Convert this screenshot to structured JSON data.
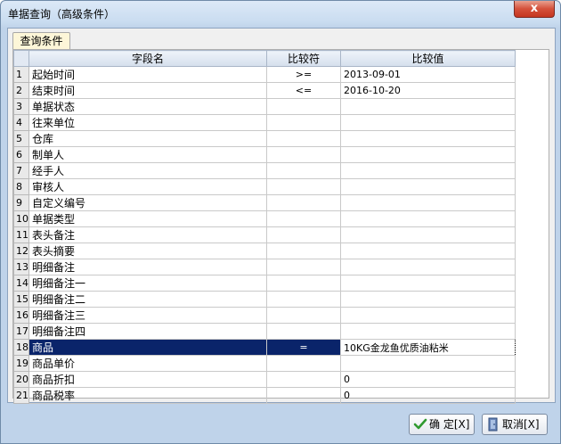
{
  "window": {
    "title": "单据查询（高级条件）",
    "close_label": "x"
  },
  "tabs": [
    {
      "label": "查询条件",
      "active": true
    }
  ],
  "grid": {
    "headers": {
      "name": "字段名",
      "operator": "比较符",
      "value": "比较值"
    },
    "rows": [
      {
        "num": "1",
        "name": "起始时间",
        "operator": ">=",
        "value": "2013-09-01"
      },
      {
        "num": "2",
        "name": "结束时间",
        "operator": "<=",
        "value": "2016-10-20"
      },
      {
        "num": "3",
        "name": "单据状态",
        "operator": "",
        "value": ""
      },
      {
        "num": "4",
        "name": "往来单位",
        "operator": "",
        "value": ""
      },
      {
        "num": "5",
        "name": "仓库",
        "operator": "",
        "value": ""
      },
      {
        "num": "6",
        "name": "制单人",
        "operator": "",
        "value": ""
      },
      {
        "num": "7",
        "name": "经手人",
        "operator": "",
        "value": ""
      },
      {
        "num": "8",
        "name": "审核人",
        "operator": "",
        "value": ""
      },
      {
        "num": "9",
        "name": "自定义编号",
        "operator": "",
        "value": ""
      },
      {
        "num": "10",
        "name": "单据类型",
        "operator": "",
        "value": ""
      },
      {
        "num": "11",
        "name": "表头备注",
        "operator": "",
        "value": ""
      },
      {
        "num": "12",
        "name": "表头摘要",
        "operator": "",
        "value": ""
      },
      {
        "num": "13",
        "name": "明细备注",
        "operator": "",
        "value": ""
      },
      {
        "num": "14",
        "name": "明细备注一",
        "operator": "",
        "value": ""
      },
      {
        "num": "15",
        "name": "明细备注二",
        "operator": "",
        "value": ""
      },
      {
        "num": "16",
        "name": "明细备注三",
        "operator": "",
        "value": ""
      },
      {
        "num": "17",
        "name": "明细备注四",
        "operator": "",
        "value": ""
      },
      {
        "num": "18",
        "name": "商品",
        "operator": "=",
        "value": "10KG金龙鱼优质油粘米",
        "selected": true
      },
      {
        "num": "19",
        "name": "商品单价",
        "operator": "",
        "value": ""
      },
      {
        "num": "20",
        "name": "商品折扣",
        "operator": "",
        "value": "0"
      },
      {
        "num": "21",
        "name": "商品税率",
        "operator": "",
        "value": "0"
      }
    ]
  },
  "buttons": {
    "ok": "确 定[X]",
    "cancel": "取消[X]"
  },
  "colors": {
    "selection": "#0a246a",
    "tab_active": "#fdf6d8",
    "close_button": "#c5361f"
  },
  "icons": {
    "ok": "checkmark-icon",
    "cancel": "exit-door-icon"
  }
}
